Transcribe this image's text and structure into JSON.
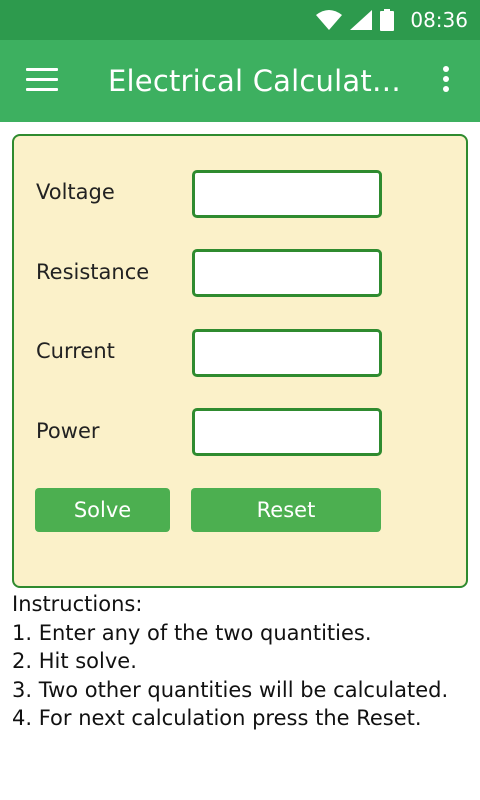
{
  "status_bar": {
    "time": "08:36"
  },
  "app_bar": {
    "title": "Electrical Calculator…",
    "menu_icon": "hamburger-menu-icon",
    "overflow_icon": "more-vert-icon"
  },
  "form": {
    "fields": [
      {
        "label": "Voltage",
        "value": ""
      },
      {
        "label": "Resistance",
        "value": ""
      },
      {
        "label": "Current",
        "value": ""
      },
      {
        "label": "Power",
        "value": ""
      }
    ],
    "solve_label": "Solve",
    "reset_label": "Reset"
  },
  "instructions": {
    "heading": "Instructions:",
    "steps": [
      "1. Enter any of the two quantities.",
      "2. Hit solve.",
      "3. Two other quantities will be calculated.",
      "4. For next calculation press the Reset."
    ]
  },
  "colors": {
    "status_bar": "#2d9a4d",
    "app_bar": "#3db060",
    "card_background": "#fbf1c9",
    "card_border": "#2f8b2f",
    "button": "#4caf50"
  }
}
